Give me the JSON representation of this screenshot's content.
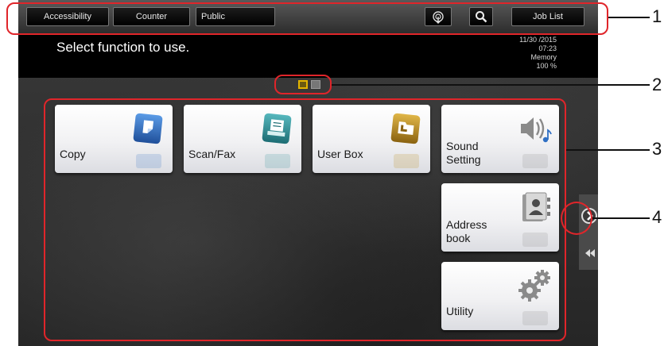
{
  "topbar": {
    "accessibility_label": "Accessibility",
    "counter_label": "Counter",
    "public_label": "Public",
    "job_list_label": "Job List"
  },
  "header": {
    "prompt": "Select function to use.",
    "date": "11/30 /2015",
    "time": "07:23",
    "memory_label": "Memory",
    "memory_value": "100 %"
  },
  "pager": {
    "current_page": 1,
    "total_pages": 2
  },
  "tiles": [
    {
      "label": "Copy",
      "icon": "copy-icon",
      "color": "#2f6fc4"
    },
    {
      "label": "Scan/Fax",
      "icon": "scan-fax-icon",
      "color": "#2a8f96"
    },
    {
      "label": "User Box",
      "icon": "user-box-icon",
      "color": "#b8860b"
    },
    {
      "label_line1": "Sound",
      "label_line2": "Setting",
      "icon": "speaker-icon",
      "color": "#4a4a4a"
    },
    {
      "label_line1": "Address",
      "label_line2": "book",
      "icon": "address-book-icon",
      "color": "#6a6a6a"
    },
    {
      "label": "Utility",
      "icon": "gear-icon",
      "color": "#555555"
    }
  ],
  "callouts": [
    "1",
    "2",
    "3",
    "4"
  ],
  "colors": {
    "callout": "#e0252a",
    "pager_active": "#e2b400"
  }
}
